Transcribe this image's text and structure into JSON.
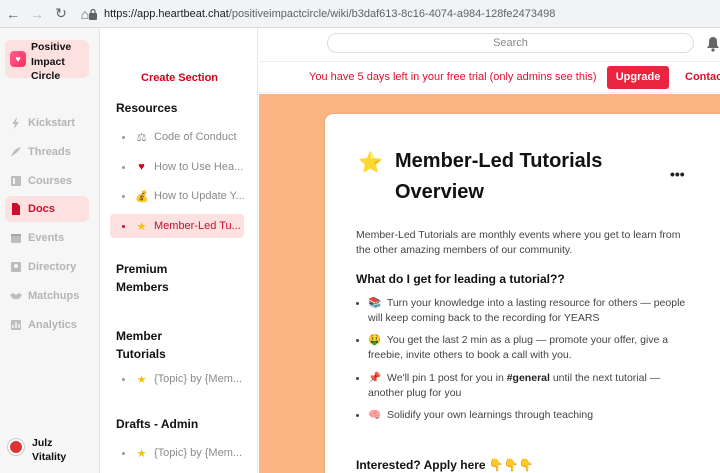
{
  "browser": {
    "url_host": "https://app.heartbeat.chat",
    "url_path": "/positiveimpactcircle/wiki/b3daf613-8c16-4074-a984-128fe2473498"
  },
  "community": {
    "name": "Positive Impact Circle"
  },
  "rail": {
    "items": [
      {
        "label": "Kickstart",
        "icon": "lightning-icon"
      },
      {
        "label": "Threads",
        "icon": "quill-icon"
      },
      {
        "label": "Courses",
        "icon": "book-icon"
      },
      {
        "label": "Docs",
        "icon": "document-icon"
      },
      {
        "label": "Events",
        "icon": "calendar-icon"
      },
      {
        "label": "Directory",
        "icon": "directory-icon"
      },
      {
        "label": "Matchups",
        "icon": "handshake-icon"
      },
      {
        "label": "Analytics",
        "icon": "chart-icon"
      }
    ],
    "active": "Docs"
  },
  "user": {
    "name": "Julz Vitality"
  },
  "sections": {
    "create_label": "Create Section",
    "groups": [
      {
        "title": "Resources",
        "items": [
          {
            "emoji": "⚖",
            "label": "Code of Conduct"
          },
          {
            "emoji": "♥",
            "label": "How to Use Hea..."
          },
          {
            "emoji": "💰",
            "label": "How to Update Y..."
          },
          {
            "emoji": "★",
            "label": "Member-Led Tu..."
          }
        ]
      },
      {
        "title": "Premium Members",
        "items": []
      },
      {
        "title": "Member Tutorials",
        "items": [
          {
            "emoji": "★",
            "label": "{Topic} by {Mem..."
          }
        ]
      },
      {
        "title": "Drafts - Admin",
        "items": [
          {
            "emoji": "★",
            "label": "{Topic} by {Mem..."
          }
        ]
      }
    ]
  },
  "header": {
    "search_placeholder": "Search",
    "trial_text": "You have 5 days left in your free trial (only admins see this)",
    "upgrade_label": "Upgrade",
    "contact_label": "Contac"
  },
  "doc": {
    "emoji": "⭐",
    "title": "Member-Led Tutorials Overview",
    "more": "•••",
    "intro": "Member-Led Tutorials are monthly events where you get to learn from the other amazing members of our community.",
    "question": "What do I get for leading a tutorial??",
    "bullets": [
      {
        "emoji": "📚",
        "text": "Turn your knowledge into a lasting resource for others — people will keep coming back to the recording for YEARS"
      },
      {
        "emoji": "🤑",
        "text": "You get the last 2 min as a plug — promote your offer, give a freebie, invite others to book a call with you."
      },
      {
        "emoji": "📌",
        "pre": "We'll pin 1 post for you in ",
        "bold": "#general",
        "post": " until the next tutorial — another plug for you"
      },
      {
        "emoji": "🧠",
        "text": "Solidify your own learnings through teaching"
      }
    ],
    "apply": "Interested? Apply here 👇👇👇"
  },
  "colors": {
    "accent": "#e8243f",
    "active_bg": "#fde0e0",
    "content_bg": "#fbb584"
  }
}
